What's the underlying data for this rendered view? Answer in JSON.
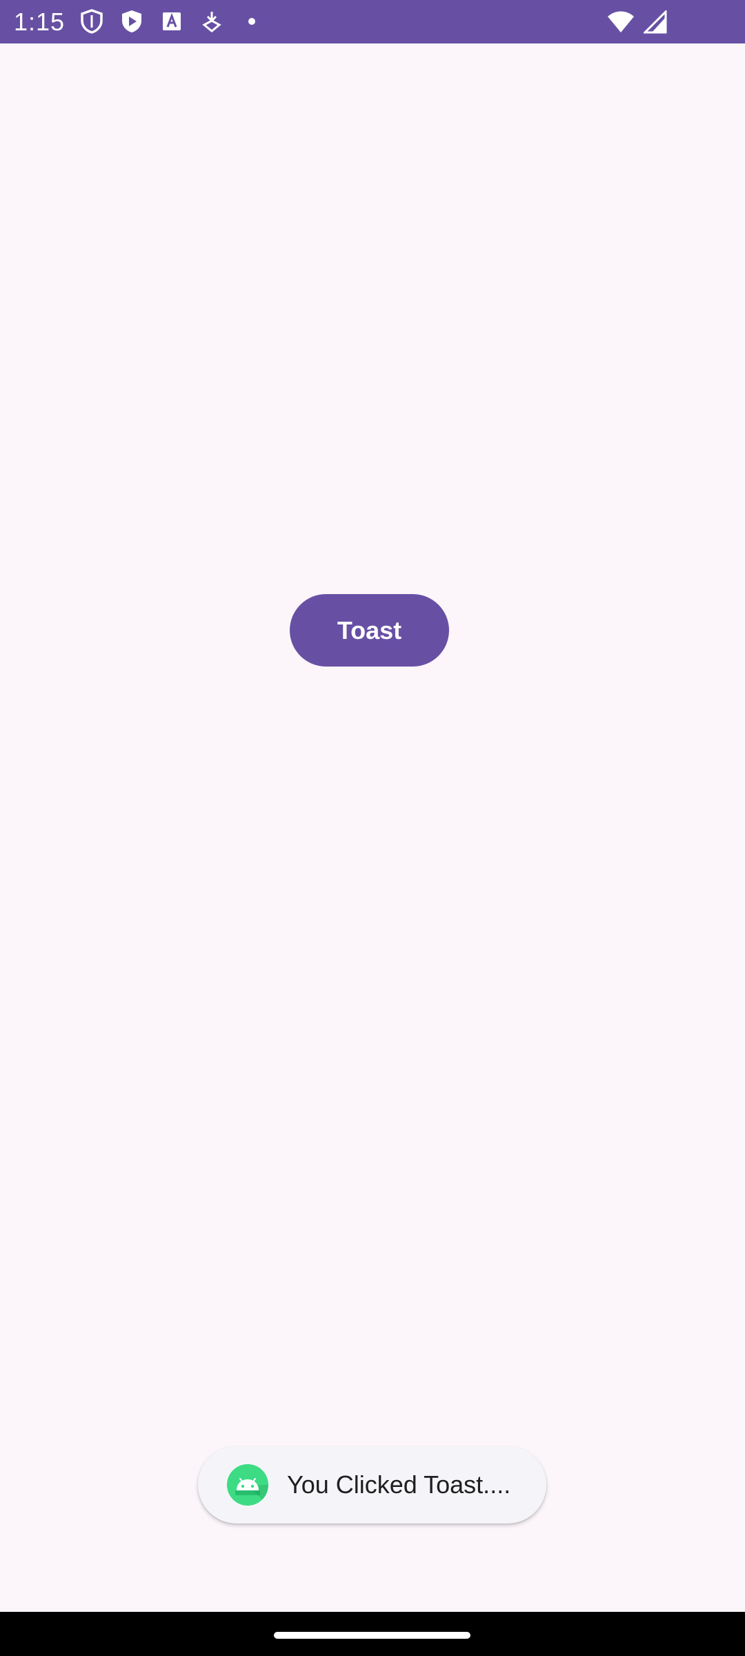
{
  "status_bar": {
    "time": "1:15",
    "background": "#6750A4",
    "left_icons": [
      "shield-icon",
      "shield-play-icon",
      "font-a-icon",
      "download-icon",
      "dot-icon"
    ],
    "right_icons": [
      "wifi-icon",
      "cell-signal-icon"
    ]
  },
  "main": {
    "button_label": "Toast",
    "button_color": "#6750A4"
  },
  "toast": {
    "message": "You Clicked Toast....",
    "icon": "android-icon"
  },
  "colors": {
    "background": "#FCF6FB",
    "accent": "#6750A4",
    "android_green": "#3DDC84"
  }
}
